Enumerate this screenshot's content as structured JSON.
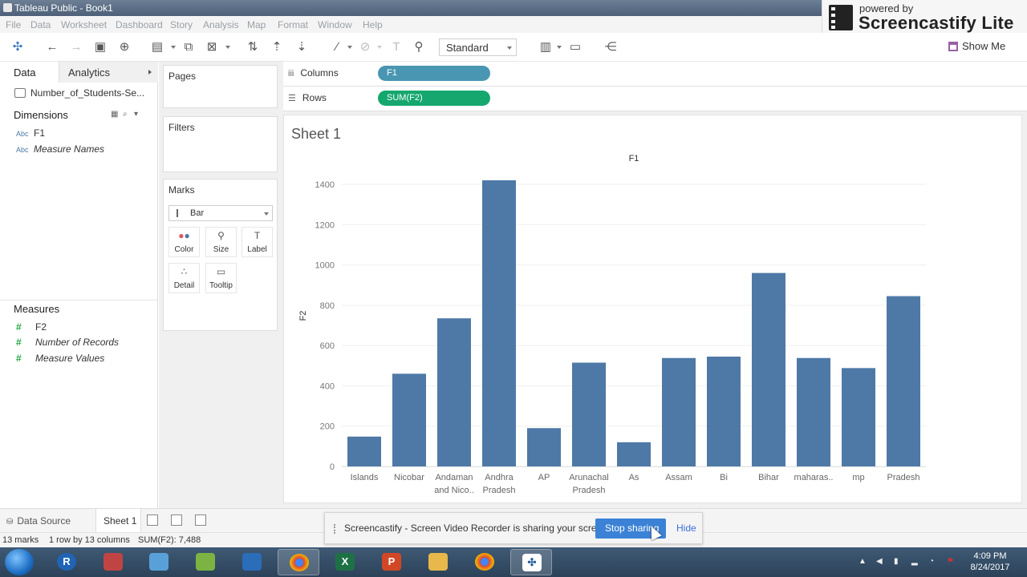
{
  "window": {
    "title": "Tableau Public - Book1"
  },
  "menu": [
    "File",
    "Data",
    "Worksheet",
    "Dashboard",
    "Story",
    "Analysis",
    "Map",
    "Format",
    "Window",
    "Help"
  ],
  "watermark": {
    "powered_by": "powered by",
    "name": "Screencastify Lite"
  },
  "toolbar": {
    "fit_value": "Standard",
    "show_me": "Show Me"
  },
  "data_pane": {
    "tab_data": "Data",
    "tab_analytics": "Analytics",
    "datasource": "Number_of_Students-Se...",
    "dimensions_label": "Dimensions",
    "dimensions": [
      {
        "type": "Abc",
        "name": "F1",
        "italic": false
      },
      {
        "type": "Abc",
        "name": "Measure Names",
        "italic": true
      }
    ],
    "measures_label": "Measures",
    "measures": [
      {
        "name": "F2",
        "italic": false
      },
      {
        "name": "Number of Records",
        "italic": true
      },
      {
        "name": "Measure Values",
        "italic": true
      }
    ]
  },
  "cards": {
    "pages": "Pages",
    "filters": "Filters",
    "marks": "Marks",
    "mark_type": "Bar",
    "mark_buttons": [
      "Color",
      "Size",
      "Label",
      "Detail",
      "Tooltip"
    ]
  },
  "shelves": {
    "columns_label": "Columns",
    "columns_pill": "F1",
    "rows_label": "Rows",
    "rows_pill": "SUM(F2)"
  },
  "sheet": {
    "title": "Sheet 1"
  },
  "chart_data": {
    "type": "bar",
    "title": "F1",
    "xlabel": "",
    "ylabel": "F2",
    "ylim": [
      0,
      1400
    ],
    "yticks": [
      0,
      200,
      400,
      600,
      800,
      1000,
      1200,
      1400
    ],
    "categories": [
      "Islands",
      "Nicobar",
      "Andaman and Nico..",
      "Andhra Pradesh",
      "AP",
      "Arunachal Pradesh",
      "As",
      "Assam",
      "Bi",
      "Bihar",
      "maharas..",
      "mp",
      "Pradesh"
    ],
    "category_lines": [
      [
        "Islands"
      ],
      [
        "Nicobar"
      ],
      [
        "Andaman",
        "and Nico.."
      ],
      [
        "Andhra",
        "Pradesh"
      ],
      [
        "AP"
      ],
      [
        "Arunachal",
        "Pradesh"
      ],
      [
        "As"
      ],
      [
        "Assam"
      ],
      [
        "Bi"
      ],
      [
        "Bihar"
      ],
      [
        "maharas.."
      ],
      [
        "mp"
      ],
      [
        "Pradesh"
      ]
    ],
    "values": [
      148,
      460,
      735,
      1420,
      190,
      515,
      120,
      538,
      545,
      960,
      538,
      488,
      845
    ],
    "color": "#4e79a7",
    "grid": true
  },
  "bottom": {
    "datasource_tab": "Data Source",
    "sheet_tab": "Sheet 1"
  },
  "status": {
    "marks": "13 marks",
    "rows_cols": "1 row by 13 columns",
    "sum": "SUM(F2): 7,488"
  },
  "notification": {
    "message": "Screencastify - Screen Video Recorder is sharing your screen.",
    "stop": "Stop sharing",
    "hide": "Hide"
  },
  "taskbar": {
    "time": "4:09 PM",
    "date": "8/24/2017"
  }
}
